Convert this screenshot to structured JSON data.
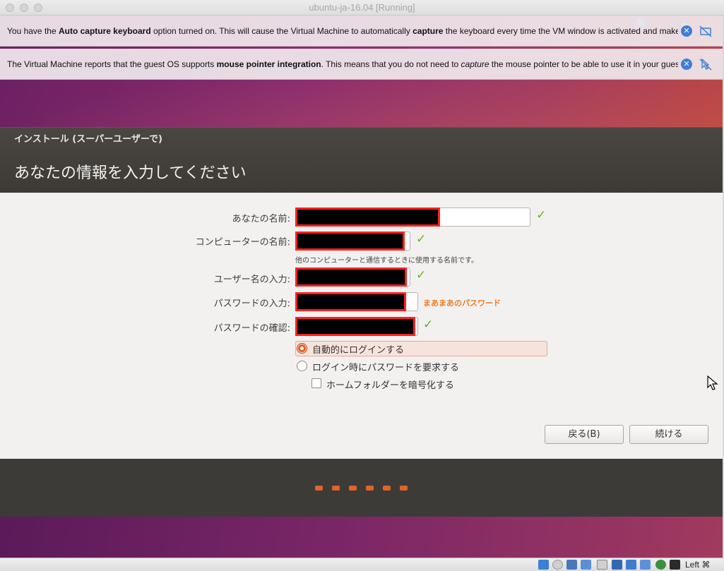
{
  "window": {
    "title": "ubuntu-ja-16.04 [Running]"
  },
  "banners": [
    {
      "parts": [
        {
          "t": "You have the ",
          "b": false
        },
        {
          "t": "Auto capture keyboard",
          "b": true
        },
        {
          "t": " option turned on. This will cause the Virtual Machine to automatically ",
          "b": false
        },
        {
          "t": "capture",
          "b": true
        },
        {
          "t": " the keyboard every time the VM window is activated and make",
          "b": false
        }
      ]
    },
    {
      "parts": [
        {
          "t": "The Virtual Machine reports that the guest OS supports ",
          "b": false
        },
        {
          "t": "mouse pointer integration",
          "b": true
        },
        {
          "t": ". This means that you do not need to ",
          "b": false
        },
        {
          "t": "capture",
          "b": false,
          "i": true
        },
        {
          "t": " the mouse pointer to be able to use it in your guest",
          "b": false
        }
      ]
    }
  ],
  "installer": {
    "caption": "インストール (スーパーユーザーで)",
    "title": "あなたの情報を入力してください",
    "labels": {
      "your_name": "あなたの名前:",
      "computer_name": "コンピューターの名前:",
      "username": "ユーザー名の入力:",
      "password": "パスワードの入力:",
      "confirm": "パスワードの確認:"
    },
    "computer_hint": "他のコンピューターと通信するときに使用する名前です。",
    "password_strength": "まあまあのパスワード",
    "check_glyph": "✓",
    "login_auto": "自動的にログインする",
    "login_password": "ログイン時にパスワードを要求する",
    "encrypt_home": "ホームフォルダーを暗号化する",
    "login_mode": "auto",
    "encrypt_checked": false,
    "back_button": "戻る(B)",
    "continue_button": "続ける",
    "progress_dots": 6
  },
  "statusbar": {
    "host_key": "Left ⌘"
  },
  "colors": {
    "accent": "#e0632a",
    "check": "#6bb31b",
    "strength": "#f07b22"
  }
}
